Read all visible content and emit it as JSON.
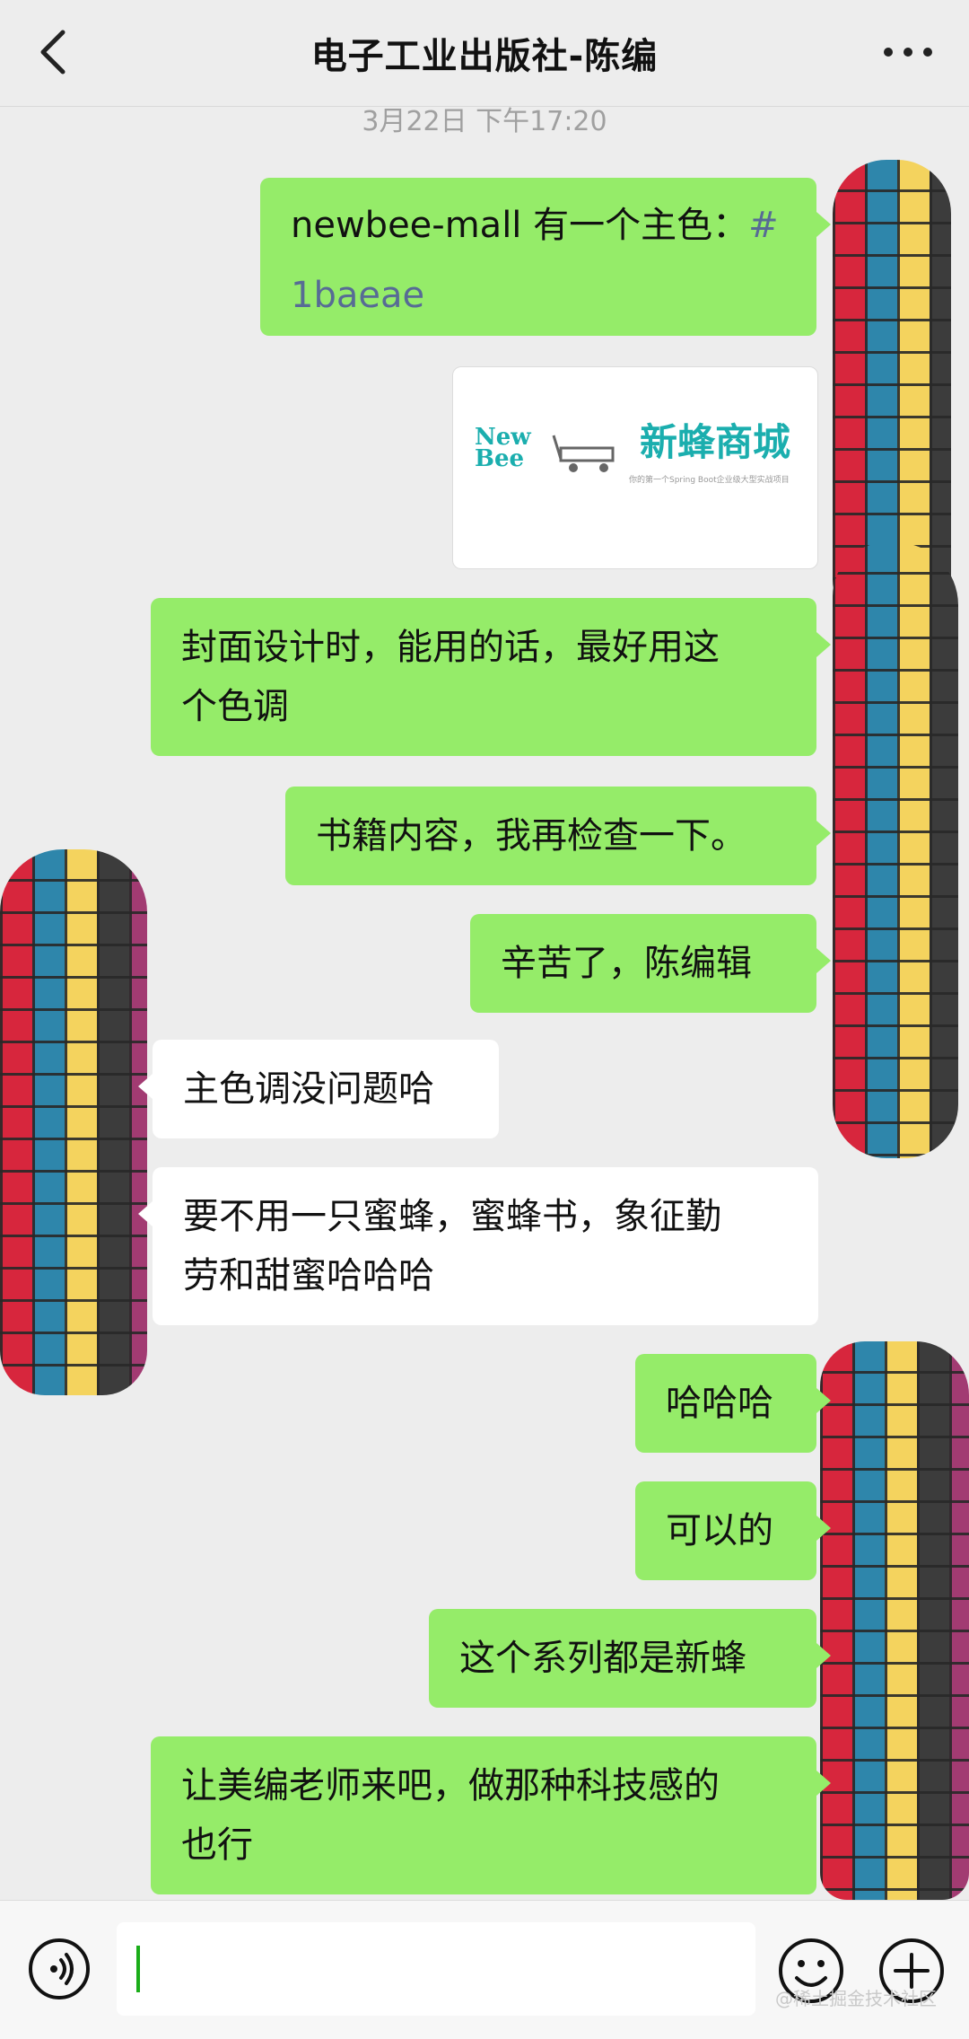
{
  "header": {
    "title": "电子工业出版社-陈编"
  },
  "chat": {
    "timestamp": "3月22日 下午17:20",
    "messages": [
      {
        "from": "me",
        "text": "newbee-mall 有一个主色：",
        "highlight": "#",
        "highlight2": "1baeae"
      },
      {
        "from": "me",
        "type": "image",
        "logo_en_1": "New",
        "logo_en_2": "Bee",
        "logo_cn": "新蜂商城",
        "tagline": "你的第一个Spring Boot企业级大型实战项目"
      },
      {
        "from": "me",
        "text_line1": "封面设计时，能用的话，最好用这",
        "text_line2": "个色调"
      },
      {
        "from": "me",
        "text": "书籍内容，我再检查一下。"
      },
      {
        "from": "me",
        "text": "辛苦了，陈编辑"
      },
      {
        "from": "other",
        "text": "主色调没问题哈"
      },
      {
        "from": "other",
        "text_line1": "要不用一只蜜蜂，蜜蜂书，象征勤",
        "text_line2": "劳和甜蜜哈哈哈"
      },
      {
        "from": "me",
        "text": "哈哈哈"
      },
      {
        "from": "me",
        "text": "可以的"
      },
      {
        "from": "me",
        "text": "这个系列都是新蜂"
      },
      {
        "from": "me",
        "text_line1": "让美编老师来吧，做那种科技感的",
        "text_line2": "也行"
      }
    ]
  },
  "bottom": {
    "watermark": "@稀土掘金技术社区"
  },
  "colors": {
    "my_bubble": "#95ec69",
    "other_bubble": "#ffffff",
    "background": "#ededed",
    "link": "#576b95"
  }
}
